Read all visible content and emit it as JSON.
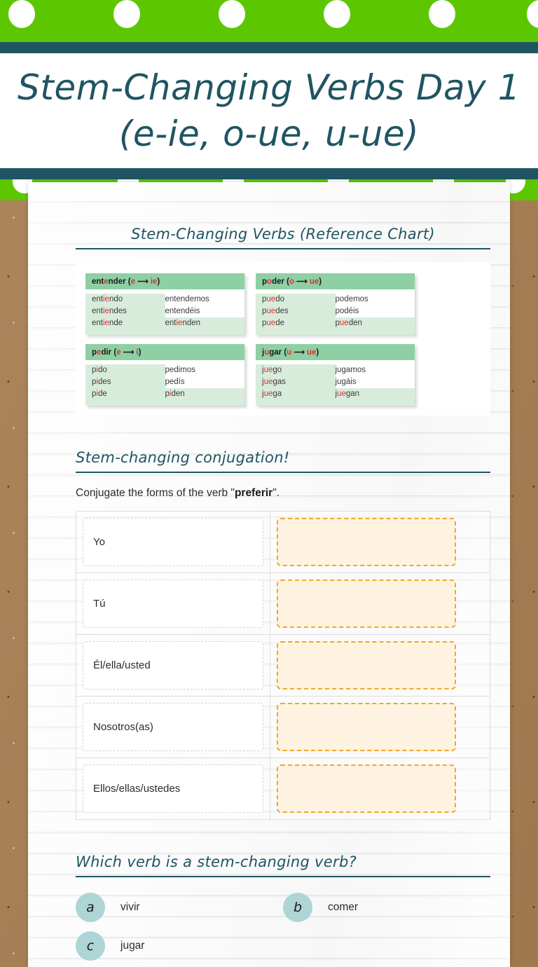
{
  "banner": {
    "hole_count": 6,
    "green": "#5cc701",
    "teal": "#1f5563"
  },
  "title": "Stem-Changing Verbs Day 1\n(e-ie, o-ue, u-ue)",
  "reference_section": {
    "heading": "Stem-Changing Verbs (Reference Chart)",
    "verbs": [
      {
        "infinitive_pre": "ent",
        "infinitive_stem": "e",
        "infinitive_post": "nder",
        "from": "e",
        "to": "ie",
        "forms": [
          {
            "left_pre": "ent",
            "left_stem": "ie",
            "left_post": "ndo",
            "right_pre": "entendemos",
            "right_stem": "",
            "right_post": ""
          },
          {
            "left_pre": "ent",
            "left_stem": "ie",
            "left_post": "ndes",
            "right_pre": "entendéis",
            "right_stem": "",
            "right_post": ""
          },
          {
            "left_pre": "ent",
            "left_stem": "ie",
            "left_post": "nde",
            "right_pre": "ent",
            "right_stem": "ie",
            "right_post": "nden"
          }
        ]
      },
      {
        "infinitive_pre": "p",
        "infinitive_stem": "o",
        "infinitive_post": "der",
        "from": "o",
        "to": "ue",
        "forms": [
          {
            "left_pre": "p",
            "left_stem": "ue",
            "left_post": "do",
            "right_pre": "podemos",
            "right_stem": "",
            "right_post": ""
          },
          {
            "left_pre": "p",
            "left_stem": "ue",
            "left_post": "des",
            "right_pre": "podéis",
            "right_stem": "",
            "right_post": ""
          },
          {
            "left_pre": "p",
            "left_stem": "ue",
            "left_post": "de",
            "right_pre": "p",
            "right_stem": "ue",
            "right_post": "den"
          }
        ]
      },
      {
        "infinitive_pre": "p",
        "infinitive_stem": "e",
        "infinitive_post": "dir",
        "from": "e",
        "to": "i",
        "forms": [
          {
            "left_pre": "p",
            "left_stem": "i",
            "left_post": "do",
            "right_pre": "pedimos",
            "right_stem": "",
            "right_post": ""
          },
          {
            "left_pre": "p",
            "left_stem": "i",
            "left_post": "des",
            "right_pre": "pedís",
            "right_stem": "",
            "right_post": ""
          },
          {
            "left_pre": "p",
            "left_stem": "i",
            "left_post": "de",
            "right_pre": "p",
            "right_stem": "i",
            "right_post": "den"
          }
        ]
      },
      {
        "infinitive_pre": "j",
        "infinitive_stem": "u",
        "infinitive_post": "gar",
        "from": "u",
        "to": "ue",
        "forms": [
          {
            "left_pre": "j",
            "left_stem": "ue",
            "left_post": "go",
            "right_pre": "jugamos",
            "right_stem": "",
            "right_post": ""
          },
          {
            "left_pre": "j",
            "left_stem": "ue",
            "left_post": "gas",
            "right_pre": "jugáis",
            "right_stem": "",
            "right_post": ""
          },
          {
            "left_pre": "j",
            "left_stem": "ue",
            "left_post": "ga",
            "right_pre": "j",
            "right_stem": "ue",
            "right_post": "gan"
          }
        ]
      }
    ]
  },
  "conjugation_section": {
    "heading": "Stem-changing conjugation!",
    "prompt_before": "Conjugate the forms of the verb \"",
    "prompt_verb": "preferir",
    "prompt_after": "\".",
    "rows": [
      {
        "pronoun": "Yo",
        "answer": ""
      },
      {
        "pronoun": "Tú",
        "answer": ""
      },
      {
        "pronoun": "Él/ella/usted",
        "answer": ""
      },
      {
        "pronoun": "Nosotros(as)",
        "answer": ""
      },
      {
        "pronoun": "Ellos/ellas/ustedes",
        "answer": ""
      }
    ]
  },
  "question_section": {
    "heading": "Which verb is a stem-changing verb?",
    "options": [
      {
        "letter": "a",
        "label": "vivir"
      },
      {
        "letter": "b",
        "label": "comer"
      },
      {
        "letter": "c",
        "label": "jugar"
      }
    ]
  },
  "colors": {
    "accent_teal": "#1f5563",
    "banner_green": "#5cc701",
    "answer_orange": "#f5a623",
    "answer_fill": "#fdf3e0",
    "bubble_blue": "#aed5d5",
    "table_head_green": "#8fcfa4",
    "table_cell_green": "#d8ecdc",
    "stem_red": "#e03030",
    "cork_brown": "#a97f53"
  }
}
